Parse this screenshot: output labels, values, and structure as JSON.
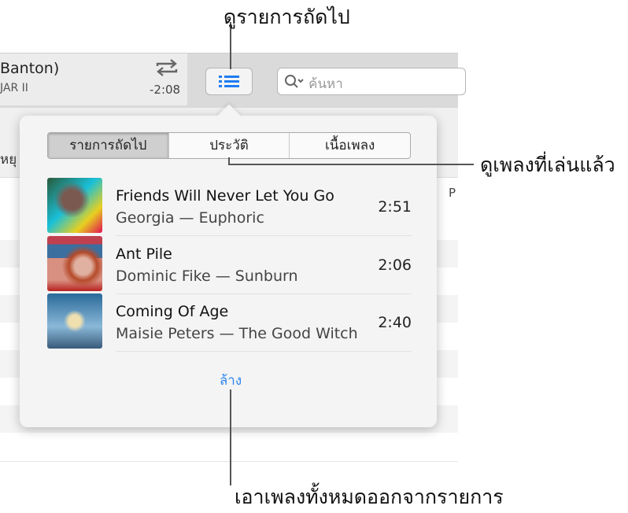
{
  "now_playing": {
    "title_fragment": "Banton)",
    "subtitle_fragment": "JAR II",
    "remaining": "-2:08",
    "repeat_icon": "repeat-icon"
  },
  "toolbar": {
    "queue_icon": "numbered-list-icon",
    "search_placeholder": "ค้นหา",
    "accent": "#1f7cf2"
  },
  "background": {
    "stop_fragment": "หยุ",
    "col_fragment": "P"
  },
  "popover": {
    "tabs": [
      {
        "label": "รายการถัดไป",
        "selected": true
      },
      {
        "label": "ประวัติ",
        "selected": false
      },
      {
        "label": "เนื้อเพลง",
        "selected": false
      }
    ],
    "tracks": [
      {
        "title": "Friends Will Never Let You Go",
        "subtitle": "Georgia — Euphoric",
        "duration": "2:51"
      },
      {
        "title": "Ant Pile",
        "subtitle": "Dominic Fike — Sunburn",
        "duration": "2:06"
      },
      {
        "title": "Coming Of Age",
        "subtitle": "Maisie Peters — The Good Witch",
        "duration": "2:40"
      }
    ],
    "clear_label": "ล้าง"
  },
  "callouts": {
    "up_next": "ดูรายการถัดไป",
    "history": "ดูเพลงที่เล่นแล้ว",
    "clear": "เอาเพลงทั้งหมดออกจากรายการ"
  }
}
